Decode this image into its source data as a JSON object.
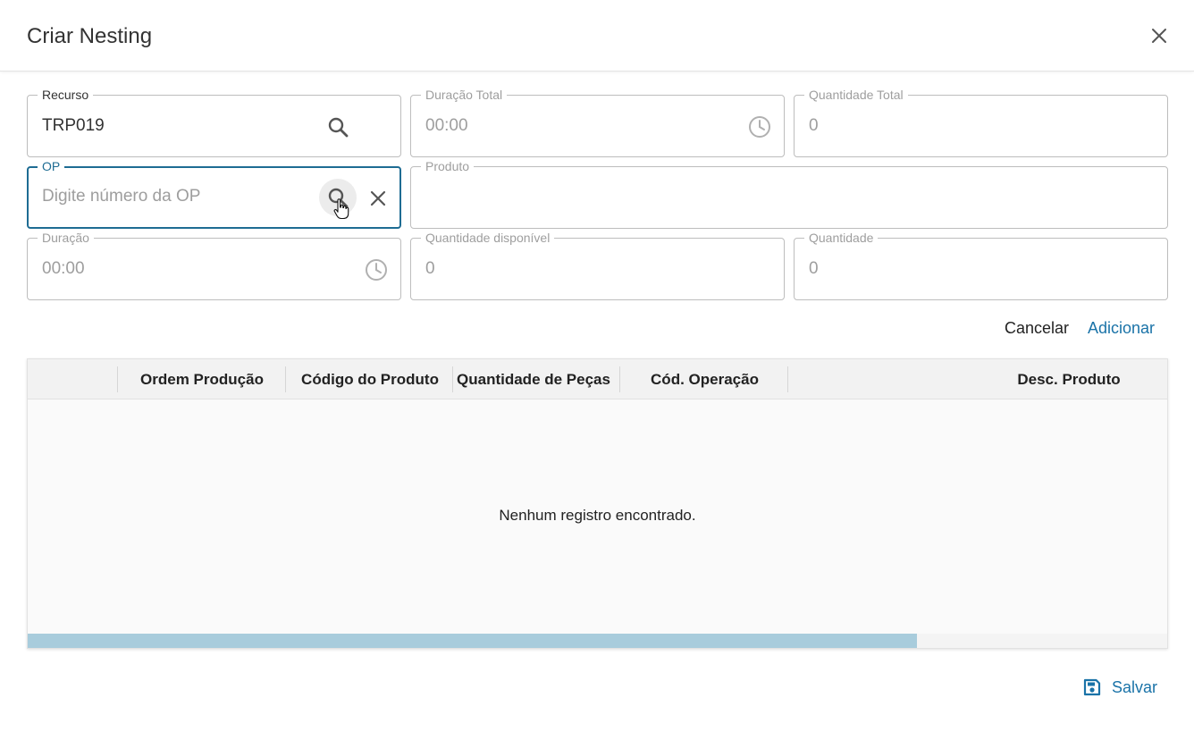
{
  "dialog": {
    "title": "Criar Nesting"
  },
  "fields": {
    "recurso": {
      "label": "Recurso",
      "value": "TRP019"
    },
    "duracao_total": {
      "label": "Duração Total",
      "value": "00:00"
    },
    "quantidade_total": {
      "label": "Quantidade Total",
      "value": "0"
    },
    "op": {
      "label": "OP",
      "placeholder": "Digite número da OP",
      "value": ""
    },
    "produto": {
      "label": "Produto",
      "value": ""
    },
    "duracao": {
      "label": "Duração",
      "value": "00:00"
    },
    "quantidade_disponivel": {
      "label": "Quantidade disponível",
      "value": "0"
    },
    "quantidade": {
      "label": "Quantidade",
      "value": "0"
    }
  },
  "actions": {
    "cancel": "Cancelar",
    "add": "Adicionar",
    "save": "Salvar"
  },
  "table": {
    "columns": [
      "Ordem Produção",
      "Código do Produto",
      "Quantidade de Peças",
      "Cód. Operação",
      "Desc. Produto"
    ],
    "empty_message": "Nenhum registro encontrado.",
    "scroll_fraction": 0.78
  },
  "colors": {
    "accent": "#1a73a8",
    "focus_border": "#1e6c93",
    "scroll_thumb": "#a8ccdc"
  },
  "icons": [
    "close-icon",
    "search-icon",
    "clock-icon",
    "clear-icon",
    "save-icon",
    "pointer-cursor-icon"
  ]
}
